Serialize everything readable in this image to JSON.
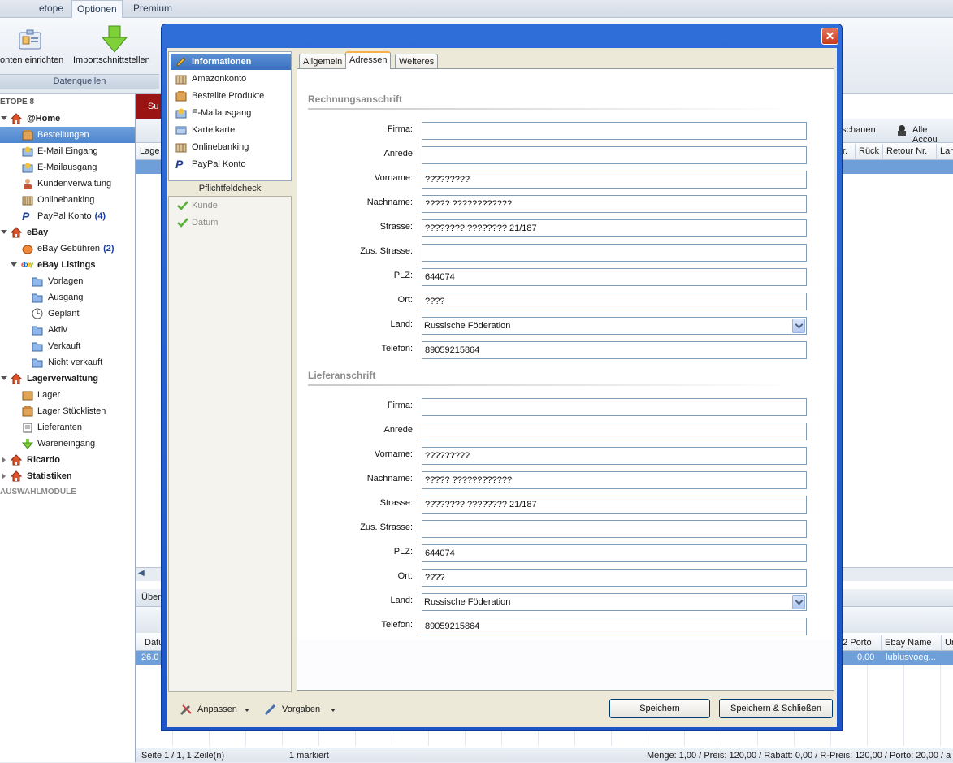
{
  "ribbon": {
    "tabs": [
      "etope",
      "Optionen",
      "Premium"
    ],
    "active_tab": "Optionen",
    "buttons": [
      "onten einrichten",
      "Importschnittstellen"
    ],
    "group_label": "Datenquellen"
  },
  "nav": {
    "root": "ETOPE 8",
    "home": "@Home",
    "bestellungen": "Bestellungen",
    "email_eingang": "E-Mail Eingang",
    "email_ausgang": "E-Mailausgang",
    "kundenverwaltung": "Kundenverwaltung",
    "onlinebanking": "Onlinebanking",
    "paypal": "PayPal Konto",
    "paypal_count": "(4)",
    "ebay": "eBay",
    "ebay_gebuehren": "eBay Gebühren",
    "ebay_gebuehren_count": "(2)",
    "ebay_listings": "eBay Listings",
    "vorlagen": "Vorlagen",
    "ausgang": "Ausgang",
    "geplant": "Geplant",
    "aktiv": "Aktiv",
    "verkauft": "Verkauft",
    "nicht_verkauft": "Nicht verkauft",
    "lagerverwaltung": "Lagerverwaltung",
    "lager": "Lager",
    "lager_stuecklisten": "Lager Stücklisten",
    "lieferanten": "Lieferanten",
    "wareneingang": "Wareneingang",
    "ricardo": "Ricardo",
    "statistiken": "Statistiken",
    "auswahlmodule": "AUSWAHLMODULE"
  },
  "background": {
    "red_tab": "Su",
    "toolbar_right": [
      "schauen",
      "Alle Accou"
    ],
    "header_left": "Lage",
    "header_cols": [
      "r.",
      "Rück",
      "Retour Nr.",
      "Lar"
    ],
    "lower_tab": "Über",
    "lower_header_left": "Datu",
    "lower_header_cols": [
      "b2 Porto",
      "Ebay Name",
      "Ur"
    ],
    "lower_row_left": "26.0",
    "lower_row_porto": "0.00",
    "lower_row_name": "lublusvoeg...",
    "status": {
      "page": "Seite 1 / 1, 1 Zeile(n)",
      "marked": "1 markiert",
      "summary": "Menge: 1,00 / Preis: 120,00 / Rabatt: 0,00 / R-Preis: 120,00 / Porto: 20,00 / a"
    }
  },
  "dialog": {
    "close": "✕",
    "left_items": [
      "Informationen",
      "Amazonkonto",
      "Bestellte Produkte",
      "E-Mailausgang",
      "Karteikarte",
      "Onlinebanking",
      "PayPal Konto"
    ],
    "pflicht_title": "Pflichtfeldcheck",
    "pflicht_items": [
      "Kunde",
      "Datum"
    ],
    "tabs": [
      "Allgemein",
      "Adressen",
      "Weiteres"
    ],
    "active_tab": "Adressen",
    "rechnung": {
      "title": "Rechnungsanschrift",
      "labels": [
        "Firma:",
        "Anrede",
        "Vorname:",
        "Nachname:",
        "Strasse:",
        "Zus. Strasse:",
        "PLZ:",
        "Ort:",
        "Land:",
        "Telefon:"
      ],
      "values": {
        "firma": "",
        "anrede": "",
        "vorname": "?????????",
        "nachname": "????? ????????????",
        "strasse": "???????? ???????? 21/187",
        "zus_strasse": "",
        "plz": "644074",
        "ort": "????",
        "land": "Russische Föderation",
        "telefon": "89059215864"
      }
    },
    "liefer": {
      "title": "Lieferanschrift",
      "labels": [
        "Firma:",
        "Anrede",
        "Vorname:",
        "Nachname:",
        "Strasse:",
        "Zus. Strasse:",
        "PLZ:",
        "Ort:",
        "Land:",
        "Telefon:"
      ],
      "values": {
        "firma": "",
        "anrede": "",
        "vorname": "?????????",
        "nachname": "????? ????????????",
        "strasse": "???????? ???????? 21/187",
        "zus_strasse": "",
        "plz": "644074",
        "ort": "????",
        "land": "Russische Föderation",
        "telefon": "89059215864"
      }
    },
    "footer": {
      "anpassen": "Anpassen",
      "vorgaben": "Vorgaben",
      "speichern": "Speichern",
      "speichern_schliessen": "Speichern & Schließen"
    }
  },
  "colors": {
    "selection": "#4d86cf",
    "dialog_frame": "#1c55c4",
    "section_title": "#8c8c8c"
  }
}
